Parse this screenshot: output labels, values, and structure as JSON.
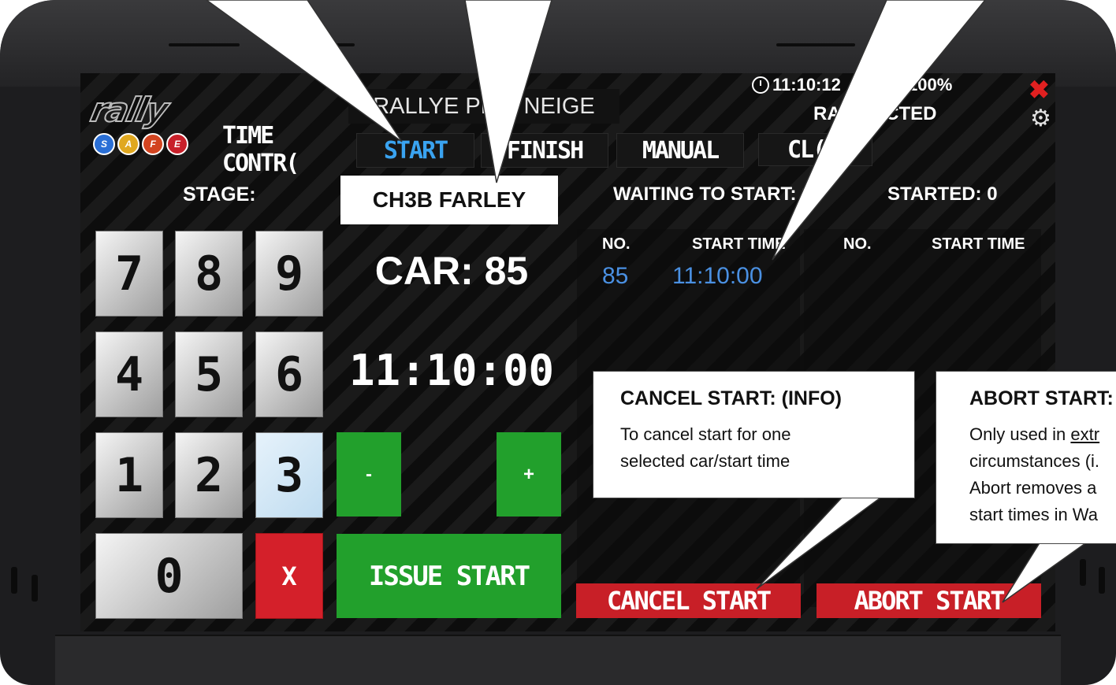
{
  "app": {
    "event_title": "RALLYE PE   E NEIGE",
    "clock": "11:10:12",
    "battery": "100%",
    "radio_status": "RA      NNECTED"
  },
  "tabs": [
    {
      "label": "TIME CONTR(",
      "active": false
    },
    {
      "label": "START",
      "active": true
    },
    {
      "label": "FINISH",
      "active": false
    },
    {
      "label": "MANUAL",
      "active": false
    },
    {
      "label": "CL(",
      "active": false
    }
  ],
  "stage": {
    "label": "STAGE:",
    "value": "CH3B FARLEY"
  },
  "keypad": {
    "keys": [
      "7",
      "8",
      "9",
      "4",
      "5",
      "6",
      "1",
      "2",
      "3",
      "0"
    ],
    "clear": "X",
    "minus": "-",
    "plus": "+",
    "issue_start": "ISSUE START"
  },
  "entry": {
    "car": "CAR: 85",
    "time": "11:10:00"
  },
  "waiting": {
    "header": "WAITING TO START: 2",
    "col_no": "NO.",
    "col_time": "START TIME",
    "rows": [
      {
        "no": "85",
        "time": "11:10:00"
      }
    ]
  },
  "started": {
    "header": "STARTED: 0",
    "col_no": "NO.",
    "col_time": "START TIME"
  },
  "actions": {
    "cancel": "CANCEL START",
    "abort": "ABORT START"
  },
  "callouts": {
    "cancel": {
      "title": "CANCEL START: (INFO)",
      "line1": "To cancel start for one",
      "line2": "selected car/start time"
    },
    "abort": {
      "title": "ABORT START:",
      "line1_pre": "Only used in ",
      "line1_u": "extr",
      "line2": "circumstances (i.",
      "line3": "Abort removes a",
      "line4": "start times in Wa"
    }
  },
  "colors": {
    "accent_blue": "#3aa3f0",
    "green": "#22a02c",
    "red": "#c81f27",
    "list_blue": "#4a90e2"
  }
}
